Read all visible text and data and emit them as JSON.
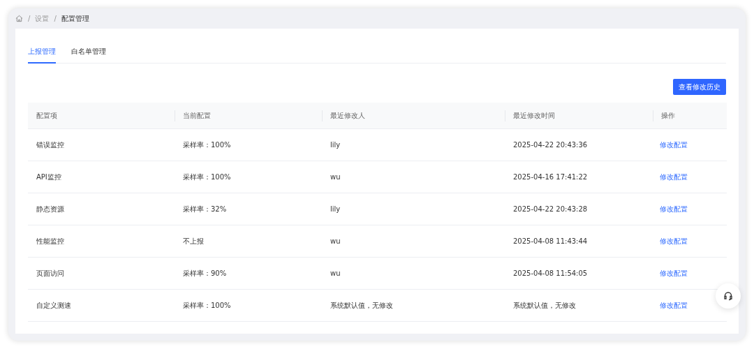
{
  "breadcrumb": [
    {
      "separator": "/",
      "label": "设置"
    },
    {
      "separator": "/",
      "label": "配置管理"
    }
  ],
  "tabs": [
    {
      "label": "上报管理",
      "selected": true
    },
    {
      "label": "白名单管理",
      "selected": false
    }
  ],
  "history_button": "查看修改历史",
  "table": {
    "columns": [
      "配置项",
      "当前配置",
      "最近修改人",
      "最近修改时间",
      "操作"
    ],
    "rows": [
      {
        "item": "错误监控",
        "config": "采样率：100%",
        "modifier": "lily",
        "time": "2025-04-22 20:43:36",
        "action": "修改配置"
      },
      {
        "item": "API监控",
        "config": "采样率：100%",
        "modifier": "wu",
        "time": "2025-04-16 17:41:22",
        "action": "修改配置"
      },
      {
        "item": "静态资源",
        "config": "采样率：32%",
        "modifier": "lily",
        "time": "2025-04-22 20:43:28",
        "action": "修改配置"
      },
      {
        "item": "性能监控",
        "config": "不上报",
        "modifier": "wu",
        "time": "2025-04-08 11:43:44",
        "action": "修改配置"
      },
      {
        "item": "页面访问",
        "config": "采样率：90%",
        "modifier": "wu",
        "time": "2025-04-08 11:54:05",
        "action": "修改配置"
      },
      {
        "item": "自定义测速",
        "config": "采样率：100%",
        "modifier": "系统默认值，无修改",
        "time": "系统默认值，无修改",
        "action": "修改配置"
      }
    ]
  }
}
